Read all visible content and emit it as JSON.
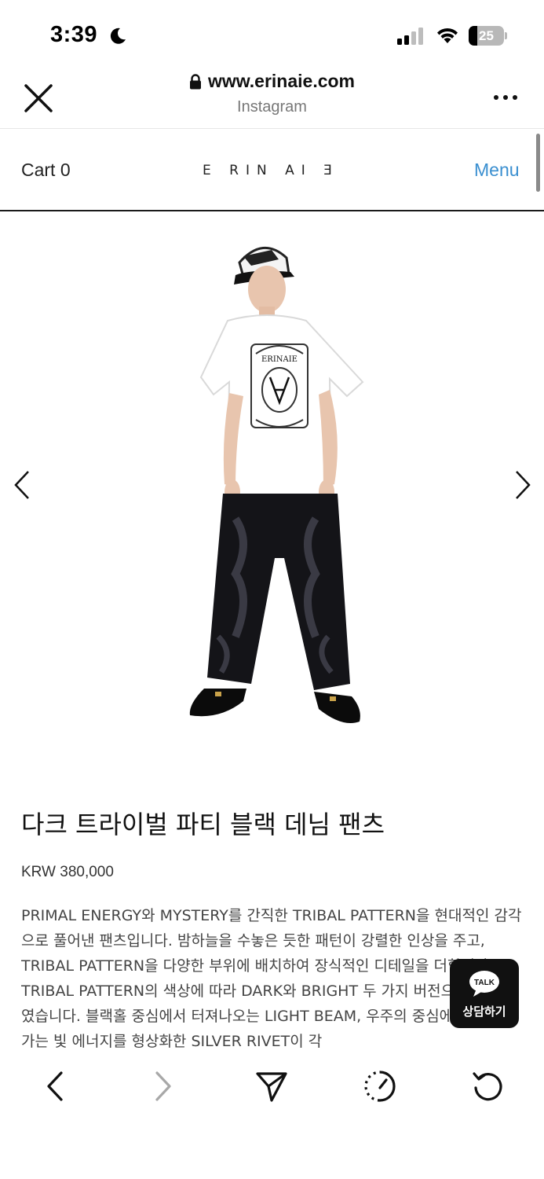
{
  "status_bar": {
    "time": "3:39",
    "battery_percent": "25",
    "battery_level": 0.25
  },
  "browser": {
    "url": "www.erinaie.com",
    "source": "Instagram"
  },
  "site_header": {
    "cart_label": "Cart 0",
    "logo_text": "E RIN AI Ǝ",
    "menu_label": "Menu"
  },
  "product": {
    "title": "다크 트라이벌 파티 블랙 데님 팬츠",
    "price": "KRW 380,000",
    "description": "PRIMAL ENERGY와 MYSTERY를 간직한 TRIBAL PATTERN을 현대적인 감각으로 풀어낸 팬츠입니다. 밤하늘을 수놓은 듯한 패턴이 강렬한 인상을 주고, TRIBAL PATTERN을 다양한 부위에 배치하여 장식적인 디테일을 더합니다. TRIBAL PATTERN의 색상에 따라 DARK와 BRIGHT 두 가지 버전으로 제작하였습니다. 블랙홀 중심에서 터져나오는 LIGHT BEAM, 우주의 중심에서 퍼져나가는 빛 에너지를 형상화한 SILVER RIVET이 각"
  },
  "talk": {
    "badge": "TALK",
    "label": "상담하기"
  },
  "colors": {
    "menu": "#3a8fd0",
    "talk_bg": "#111111"
  },
  "icons": {
    "close": "close-icon",
    "lock": "lock-icon",
    "more": "more-icon",
    "prev": "chevron-left-icon",
    "next": "chevron-right-icon",
    "share": "send-icon",
    "speed": "speed-icon",
    "reload": "reload-icon"
  }
}
